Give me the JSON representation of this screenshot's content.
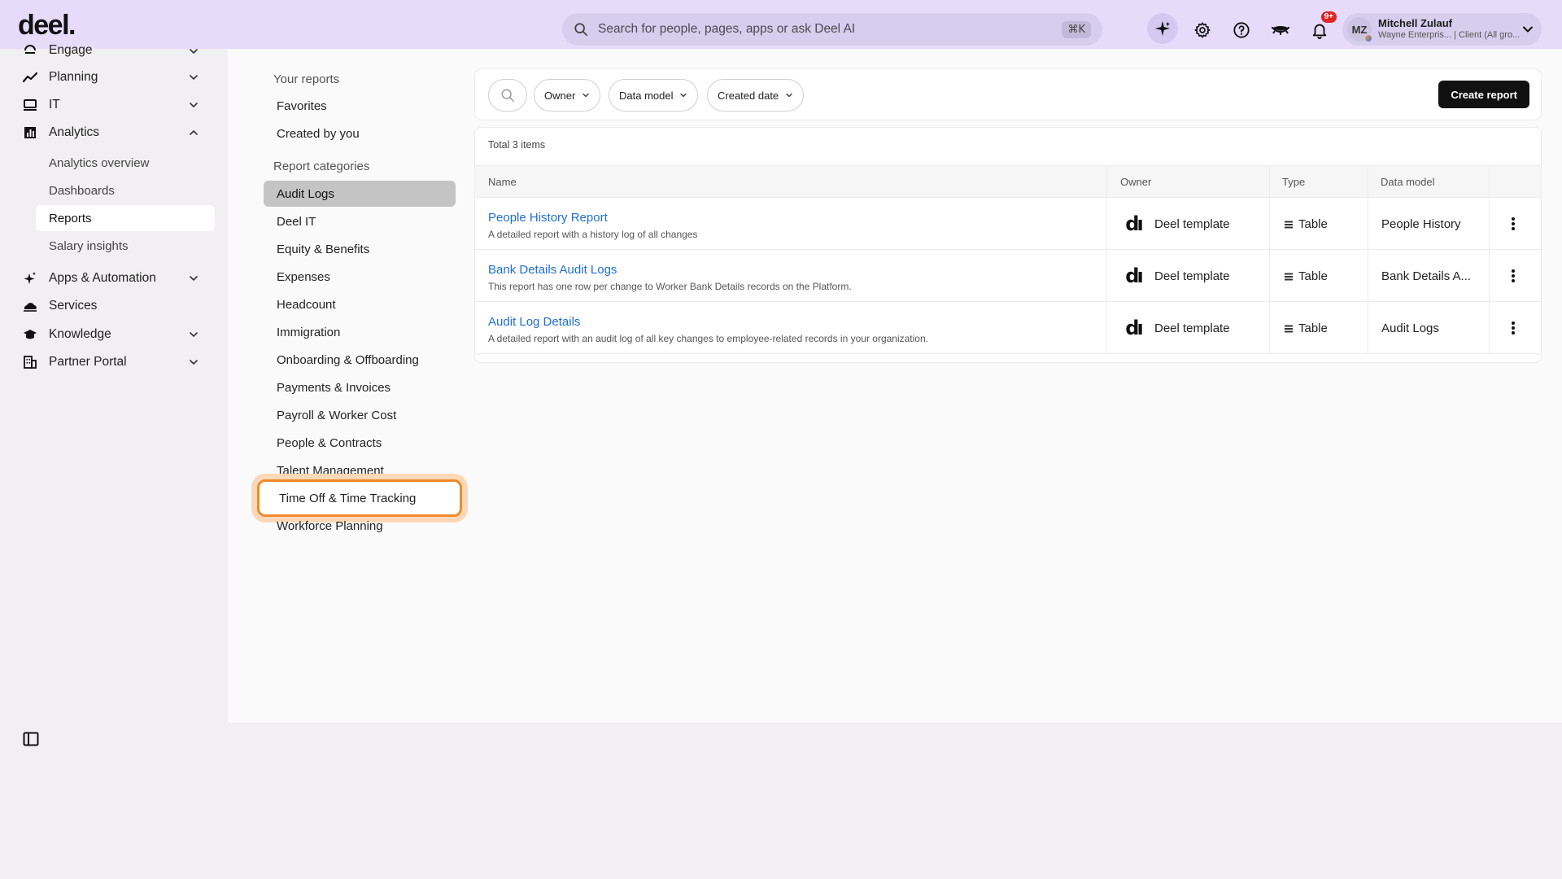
{
  "topbar": {
    "logo": "deel",
    "search_placeholder": "Search for people, pages, apps or ask Deel AI",
    "search_shortcut": "⌘K",
    "notifications_badge": "9+",
    "user": {
      "initials": "MZ",
      "name": "Mitchell Zulauf",
      "subtitle": "Wayne Enterpris... | Client (All gro..."
    }
  },
  "sidebar": {
    "items": [
      {
        "label": "Engage",
        "icon": "engage-icon"
      },
      {
        "label": "Planning",
        "icon": "trend-icon"
      },
      {
        "label": "IT",
        "icon": "laptop-icon"
      },
      {
        "label": "Analytics",
        "icon": "analytics-icon"
      },
      {
        "label": "Apps & Automation",
        "icon": "sparkle-icon"
      },
      {
        "label": "Services",
        "icon": "cloud-icon"
      },
      {
        "label": "Knowledge",
        "icon": "graduation-cap-icon"
      },
      {
        "label": "Partner Portal",
        "icon": "building-icon"
      }
    ],
    "analytics_sub": [
      "Analytics overview",
      "Dashboards",
      "Reports",
      "Salary insights"
    ],
    "active_sub": "Reports"
  },
  "categories": {
    "your_reports_heading": "Your reports",
    "your_reports": [
      "Favorites",
      "Created by you"
    ],
    "report_categories_heading": "Report categories",
    "items": [
      "Audit Logs",
      "Deel IT",
      "Equity & Benefits",
      "Expenses",
      "Headcount",
      "Immigration",
      "Onboarding & Offboarding",
      "Payments & Invoices",
      "Payroll & Worker Cost",
      "People & Contracts",
      "Talent Management",
      "Time Off & Time Tracking",
      "Workforce Planning"
    ],
    "selected": "Audit Logs",
    "focused": "Time Off & Time Tracking"
  },
  "toolbar": {
    "filters": [
      "Owner",
      "Data model",
      "Created date"
    ],
    "create_label": "Create report"
  },
  "table": {
    "total_label": "Total 3 items",
    "columns": [
      "Name",
      "Owner",
      "Type",
      "Data model"
    ],
    "rows": [
      {
        "name": "People History Report",
        "description": "A detailed report with a history log of all changes",
        "owner": "Deel template",
        "type": "Table",
        "data_model": "People History"
      },
      {
        "name": "Bank Details Audit Logs",
        "description": "This report has one row per change to Worker Bank Details records on the Platform.",
        "owner": "Deel template",
        "type": "Table",
        "data_model": "Bank Details A..."
      },
      {
        "name": "Audit Log Details",
        "description": "A detailed report with an audit log of all key changes to employee-related records in your organization.",
        "owner": "Deel template",
        "type": "Table",
        "data_model": "Audit Logs"
      }
    ]
  },
  "colors": {
    "topbar_bg": "#e6dcfa",
    "link": "#1f6ed4",
    "focus_ring": "#f28a2b",
    "selected_category": "#c4c4c4"
  }
}
